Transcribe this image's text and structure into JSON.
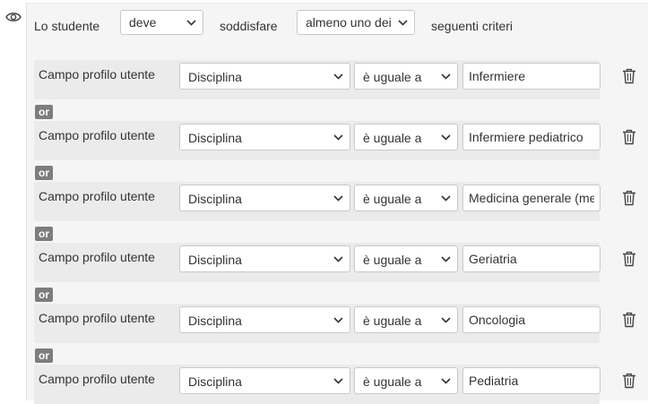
{
  "header": {
    "prefix_text": "Lo studente",
    "requirement_select": "deve",
    "middle_text": "soddisfare",
    "scope_select": "almeno uno dei",
    "suffix_text": "seguenti criteri"
  },
  "icons": {
    "visibility": "eye-icon",
    "delete": "trash-icon",
    "dropdown": "chevron-down-icon"
  },
  "colors": {
    "panel_bg": "#f5f5f5",
    "rule_bg": "#ebebeb",
    "or_badge_bg": "#7d7d7d"
  },
  "rules": [
    {
      "label": "Campo profilo utente",
      "field": "Disciplina",
      "operator": "è uguale a",
      "value": "Infermiere",
      "connector": "or"
    },
    {
      "label": "Campo profilo utente",
      "field": "Disciplina",
      "operator": "è uguale a",
      "value": "Infermiere pediatrico",
      "connector": "or"
    },
    {
      "label": "Campo profilo utente",
      "field": "Disciplina",
      "operator": "è uguale a",
      "value": "Medicina generale (medici di famiglia)",
      "connector": "or"
    },
    {
      "label": "Campo profilo utente",
      "field": "Disciplina",
      "operator": "è uguale a",
      "value": "Geriatria",
      "connector": "or"
    },
    {
      "label": "Campo profilo utente",
      "field": "Disciplina",
      "operator": "è uguale a",
      "value": "Oncologia",
      "connector": "or"
    },
    {
      "label": "Campo profilo utente",
      "field": "Disciplina",
      "operator": "è uguale a",
      "value": "Pediatria",
      "connector": ""
    }
  ]
}
